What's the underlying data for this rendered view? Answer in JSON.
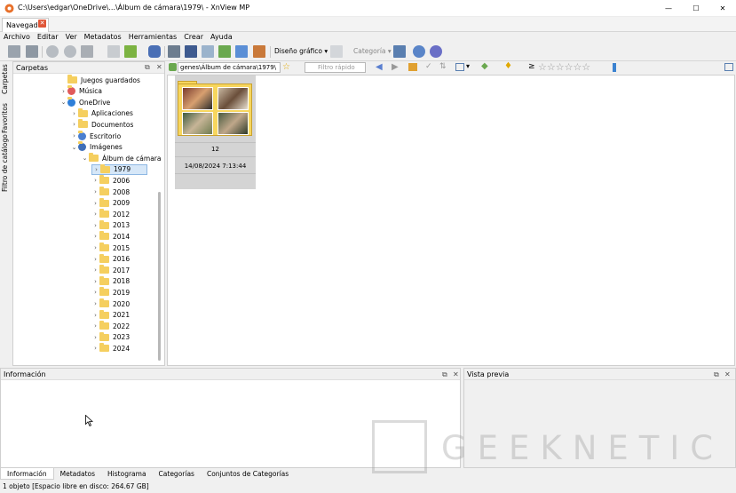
{
  "window": {
    "title": "C:\\Users\\edgar\\OneDrive\\...\\Álbum de cámara\\1979\\ - XnView MP",
    "minimize": "—",
    "maximize": "☐",
    "close": "✕"
  },
  "tabs": [
    {
      "label": "Navegador",
      "close": "✕"
    }
  ],
  "menu": [
    "Archivo",
    "Editar",
    "Ver",
    "Metadatos",
    "Herramientas",
    "Crear",
    "Ayuda"
  ],
  "toolbar": {
    "layout_label": "Diseño gráfico",
    "category_label": "Categoría",
    "icons": [
      "fullscreen-icon",
      "fit-icon",
      "rotate-left-icon",
      "rotate-right-icon",
      "print-icon",
      "folder-add-icon",
      "binoculars-icon",
      "printer-icon",
      "scanner-icon",
      "image-icon",
      "compare-icon",
      "slideshow-icon",
      "webpage-icon",
      "settings-icon",
      "help-icon"
    ]
  },
  "siderail": {
    "tabs": [
      "Carpetas",
      "Favoritos",
      "Filtro de catálogo"
    ]
  },
  "folders_panel": {
    "title": "Carpetas",
    "items": [
      {
        "label": "Juegos guardados",
        "indent": 0
      },
      {
        "label": "Música",
        "indent": 0
      },
      {
        "label": "OneDrive",
        "indent": 0
      },
      {
        "label": "Aplicaciones",
        "indent": 1
      },
      {
        "label": "Documentos",
        "indent": 1
      },
      {
        "label": "Escritorio",
        "indent": 1
      },
      {
        "label": "Imágenes",
        "indent": 1
      },
      {
        "label": "Álbum de cámara",
        "indent": 2
      },
      {
        "label": "1979",
        "indent": 3,
        "selected": true
      },
      {
        "label": "2006",
        "indent": 3
      },
      {
        "label": "2008",
        "indent": 3
      },
      {
        "label": "2009",
        "indent": 3
      },
      {
        "label": "2012",
        "indent": 3
      },
      {
        "label": "2013",
        "indent": 3
      },
      {
        "label": "2014",
        "indent": 3
      },
      {
        "label": "2015",
        "indent": 3
      },
      {
        "label": "2016",
        "indent": 3
      },
      {
        "label": "2017",
        "indent": 3
      },
      {
        "label": "2018",
        "indent": 3
      },
      {
        "label": "2019",
        "indent": 3
      },
      {
        "label": "2020",
        "indent": 3
      },
      {
        "label": "2021",
        "indent": 3
      },
      {
        "label": "2022",
        "indent": 3
      },
      {
        "label": "2023",
        "indent": 3
      },
      {
        "label": "2024",
        "indent": 3
      }
    ]
  },
  "pathbar": {
    "path": "genes\\Álbum de cámara\\1979\\",
    "filter_placeholder": "Filtro rápido",
    "rating_stars": "☆☆☆☆☆☆",
    "rating_prefix": "≥"
  },
  "browser": {
    "items": [
      {
        "name": "12",
        "date": "14/08/2024 7:13:44"
      }
    ]
  },
  "info_panel": {
    "title": "Información"
  },
  "preview_panel": {
    "title": "Vista previa"
  },
  "bottom_tabs": [
    "Información",
    "Metadatos",
    "Histograma",
    "Categorías",
    "Conjuntos de Categorías"
  ],
  "status": "1 objeto [Espacio libre en disco: 264.67 GB]",
  "watermark": "GEEKNETIC",
  "colors": {
    "accent": "#f5cf5f",
    "selection": "#d6e7f8"
  }
}
